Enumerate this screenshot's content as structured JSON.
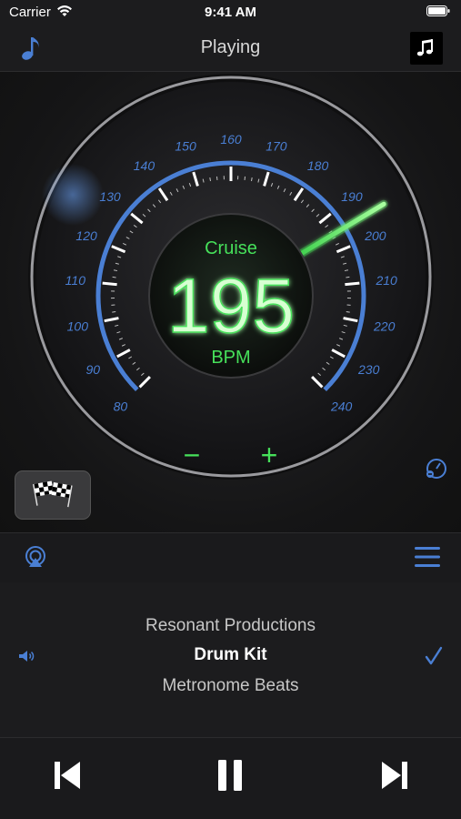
{
  "status_bar": {
    "carrier": "Carrier",
    "time": "9:41 AM"
  },
  "nav": {
    "title": "Playing",
    "left_icon": "music-note-icon",
    "right_icon": "music-notes-icon"
  },
  "gauge": {
    "mode_label": "Cruise",
    "value": "195",
    "unit": "BPM",
    "minus_label": "−",
    "plus_label": "+",
    "scale_min": 80,
    "scale_max": 240,
    "scale_labels": [
      "80",
      "90",
      "100",
      "110",
      "120",
      "130",
      "140",
      "150",
      "160",
      "170",
      "180",
      "190",
      "200",
      "210",
      "220",
      "230",
      "240"
    ],
    "needle_value": 195,
    "accent_color": "#4a7fd4",
    "glow_color": "#46e05a"
  },
  "toolbar": {
    "left_icon": "airplay-icon",
    "right_icon": "list-icon"
  },
  "picker": {
    "above": "Resonant Productions",
    "selected": "Drum Kit",
    "below": "Metronome Beats"
  },
  "transport": {
    "prev_icon": "skip-back-icon",
    "pause_icon": "pause-icon",
    "next_icon": "skip-forward-icon"
  }
}
